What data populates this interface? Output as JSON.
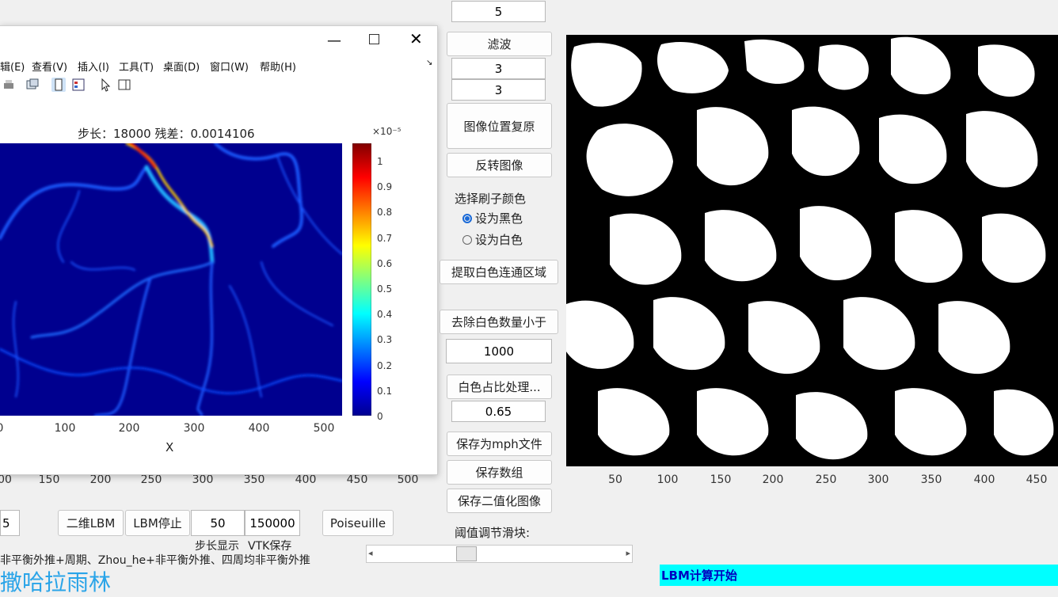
{
  "figure": {
    "menu": [
      "辑(E)",
      "查看(V)",
      "插入(I)",
      "工具(T)",
      "桌面(D)",
      "窗口(W)",
      "帮助(H)"
    ],
    "plot_title": "步长：18000  残差：0.0014106",
    "colorbar_exponent": "×10⁻⁵",
    "colorbar_ticks": [
      "1",
      "0.9",
      "0.8",
      "0.7",
      "0.6",
      "0.5",
      "0.4",
      "0.3",
      "0.2",
      "0.1",
      "0"
    ],
    "x_ticks": [
      "0",
      "100",
      "200",
      "300",
      "400",
      "500"
    ],
    "xlabel": "X"
  },
  "bg_axis_ticks": [
    "00",
    "150",
    "200",
    "250",
    "300",
    "350",
    "400",
    "450",
    "500"
  ],
  "controls": {
    "top_value": "5",
    "filter_button": "滤波",
    "filter_v1": "3",
    "filter_v2": "3",
    "reset_button": "图像位置复原",
    "invert_button": "反转图像",
    "brush_label": "选择刷子颜色",
    "radio_black": "设为黑色",
    "radio_white": "设为白色",
    "extract_button": "提取白色连通区域",
    "remove_button": "去除白色数量小于",
    "remove_value": "1000",
    "ratio_button": "白色占比处理...",
    "ratio_value": "0.65",
    "save_mph_button": "保存为mph文件",
    "save_array_button": "保存数组",
    "save_binary_button": "保存二值化图像",
    "slider_label": "阈值调节滑块:",
    "slider_value": 0.35
  },
  "bottom": {
    "left_field": "5",
    "lbm2d_button": "二维LBM",
    "lbm_stop_button": "LBM停止",
    "step_field": "50",
    "vtk_field": "150000",
    "poiseuille_button": "Poiseuille",
    "step_label": "步长显示",
    "vtk_label": "VTK保存",
    "boundary_text": "非平衡外推+周期、Zhou_he+非平衡外推、四周均非平衡外推",
    "watermark": "撒哈拉雨林",
    "status": "LBM计算开始"
  },
  "image_axis": {
    "x_ticks": [
      "50",
      "100",
      "150",
      "200",
      "250",
      "300",
      "350",
      "400",
      "450"
    ]
  },
  "colors": {
    "status_bg": "#00ffff",
    "watermark": "#2aa4e8",
    "plot_bg": "#00008f"
  }
}
